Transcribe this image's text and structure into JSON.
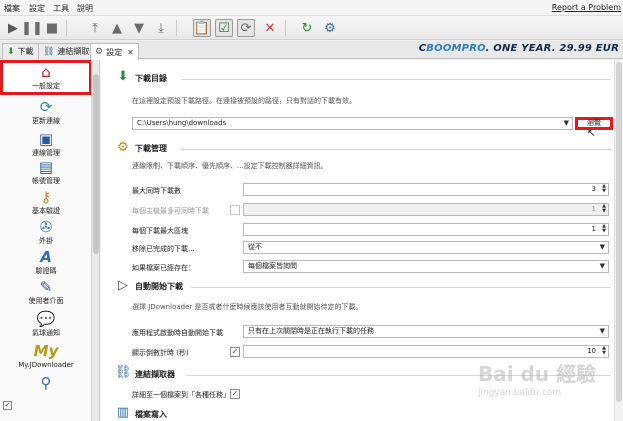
{
  "menu": {
    "items": [
      "檔案",
      "設定",
      "工具",
      "說明"
    ],
    "report_link": "Report a Problem"
  },
  "toolbar": {
    "icons": [
      "play-icon",
      "pause-icon",
      "stop-icon",
      "move-top-icon",
      "move-up-icon",
      "move-down-icon",
      "move-bottom-icon",
      "clipboard-icon",
      "auto-confirm-icon",
      "reconnect-icon",
      "remove-icon",
      "update-icon",
      "settings-icon"
    ]
  },
  "tabs": [
    {
      "label": "下載",
      "icon": "download-icon"
    },
    {
      "label": "連結擷取器",
      "icon": "link-grabber-icon"
    },
    {
      "label": "設定",
      "icon": "settings-icon"
    }
  ],
  "promo": {
    "text_a": "C",
    "text_brand": "BOOMPRO",
    "text_b": ". ONE YEAR. 29.99 EUR"
  },
  "sidebar": {
    "items": [
      {
        "label": "一般設定",
        "icon": "home-icon"
      },
      {
        "label": "更新連線",
        "icon": "reconnect-icon"
      },
      {
        "label": "連線管理",
        "icon": "connection-icon"
      },
      {
        "label": "帳號管理",
        "icon": "account-icon"
      },
      {
        "label": "基本驗證",
        "icon": "basic-auth-icon"
      },
      {
        "label": "外掛",
        "icon": "plugin-icon"
      },
      {
        "label": "驗證碼",
        "icon": "captcha-icon"
      },
      {
        "label": "使用者介面",
        "icon": "user-interface-icon"
      },
      {
        "label": "氣球通知",
        "icon": "bubble-notify-icon"
      },
      {
        "label": "My.JDownloader",
        "icon": "myjd-icon"
      }
    ]
  },
  "sections": {
    "download_dir": {
      "title": "下載目錄",
      "desc": "在這裡設定預設下載路徑。在連接被預設的路徑，只有對話的下載有效。",
      "path": "C:\\Users\\hung\\downloads",
      "browse": "瀏覽"
    },
    "download_mgmt": {
      "title": "下載管理",
      "desc": "連線限制、下載順序、優先順序、...設定下載控制器詳細資訊。",
      "rows": [
        {
          "label": "最大同時下載數",
          "value": "3"
        },
        {
          "label": "每個主機最多可同時下載",
          "value": "1"
        },
        {
          "label": "每個下載最大區塊",
          "value": "1"
        },
        {
          "label": "移除已完成的下載...",
          "value": "從不"
        },
        {
          "label": "如果檔案已經存在：",
          "value": "每個檔案皆詢問"
        }
      ]
    },
    "autostart": {
      "title": "自動開始下載",
      "desc": "選擇 JDownloader 是否或者什麼時候應該使用者互動就開始待定的下載。",
      "rows": [
        {
          "label": "應用程式啟動時自動開始下載",
          "value": "只有在上次關閉時是正在執行下載的任務"
        },
        {
          "label": "顯示倒數計時 (秒)",
          "value": "10"
        }
      ]
    },
    "link_grabber": {
      "title": "連結擷取器",
      "rows": [
        {
          "label": "詳細至一個檔案到「各種任務」"
        }
      ]
    },
    "file_writing": {
      "title": "檔案寫入"
    }
  },
  "watermark": {
    "line1": "Bai du 經驗",
    "line2": "jingyan.baidu.com"
  }
}
